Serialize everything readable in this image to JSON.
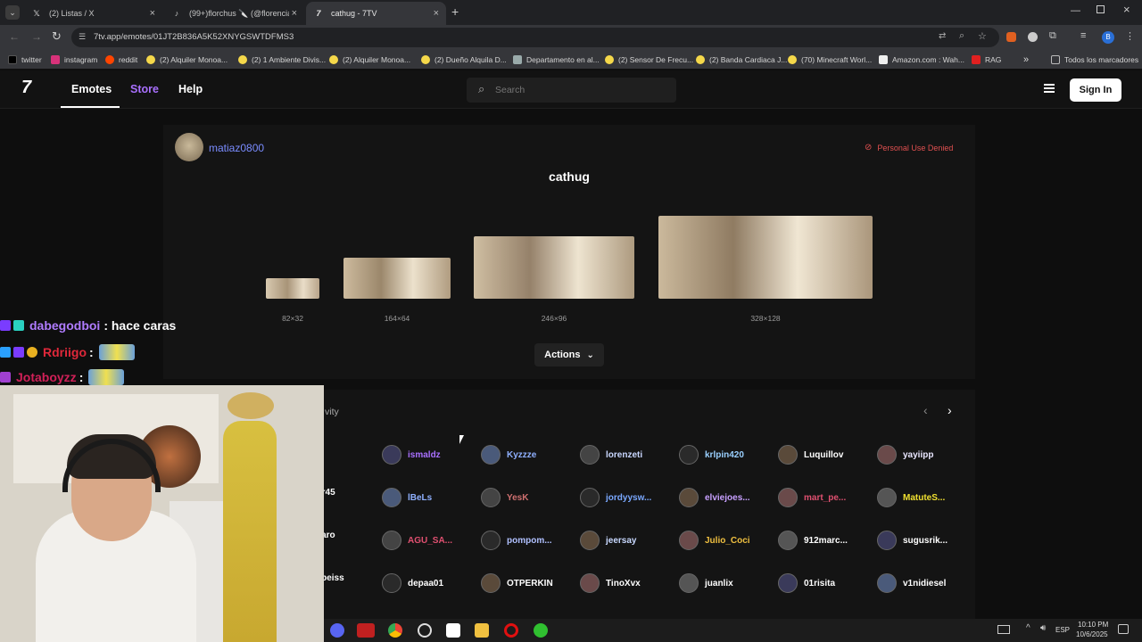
{
  "tabs": [
    {
      "label": "(2) Listas / X",
      "icon": "x-icon"
    },
    {
      "label": "(99+)florchus 🔪 (@florenciafig",
      "icon": "tiktok-icon"
    },
    {
      "label": "cathug - 7TV",
      "icon": "7tv-icon"
    }
  ],
  "address_bar": {
    "url": "7tv.app/emotes/01JT2B836A5K52XNYGSWTDFMS3"
  },
  "bookmarks": [
    {
      "label": "twitter"
    },
    {
      "label": "instagram"
    },
    {
      "label": "reddit"
    },
    {
      "label": "(2) Alquiler Monoa..."
    },
    {
      "label": "(2) 1 Ambiente Divis..."
    },
    {
      "label": "(2) Alquiler Monoa..."
    },
    {
      "label": "(2) Dueño Alquila D..."
    },
    {
      "label": "Departamento en al..."
    },
    {
      "label": "(2) Sensor De Frecu..."
    },
    {
      "label": "(2) Banda Cardiaca J..."
    },
    {
      "label": "(70) Minecraft Worl..."
    },
    {
      "label": "Amazon.com : Wah..."
    },
    {
      "label": "RAG"
    }
  ],
  "bookmarks_overflow": "»",
  "all_bookmarks": "Todos los marcadores",
  "site": {
    "logo": "7",
    "nav": {
      "emotes": "Emotes",
      "store": "Store",
      "help": "Help"
    },
    "search_placeholder": "Search",
    "sign_in": "Sign In"
  },
  "emote": {
    "owner": "matiaz0800",
    "license": "Personal Use Denied",
    "name": "cathug",
    "sizes": [
      "82×32",
      "164×64",
      "246×96",
      "328×128"
    ],
    "actions_label": "Actions"
  },
  "activity": {
    "title_partial": "vity",
    "users": [
      [
        "o",
        "ismaldz",
        "Kyzzze",
        "lorenzeti",
        "krlpin420",
        "Luquillov",
        "yayiipp"
      ],
      [
        "irr45",
        "lBeLs",
        "YesK",
        "jordyysw...",
        "elviejoes...",
        "mart_pe...",
        "MatuteS..."
      ],
      [
        "naro",
        "AGU_SA...",
        "pompom...",
        "jeersay",
        "Julio_Coci",
        "912marc...",
        "sugusrik..."
      ],
      [
        "obeiss",
        "depaa01",
        "OTPERKIN",
        "TinoXvx",
        "juanlix",
        "01risita",
        "v1nidiesel"
      ]
    ]
  },
  "chat": [
    {
      "user": "dabegodboi",
      "message": ": hace caras",
      "color": "#b07cff"
    },
    {
      "user": "Rdriigo",
      "message": ":",
      "color": "#e0283a"
    },
    {
      "user": "Jotaboyzz",
      "message": ":",
      "color": "#d02058"
    }
  ],
  "taskbar": {
    "time": "10:10 PM",
    "date": "10/6/2025",
    "lang": "ESP"
  },
  "colors": {
    "accent": "#a970ff",
    "license": "#e05050"
  }
}
